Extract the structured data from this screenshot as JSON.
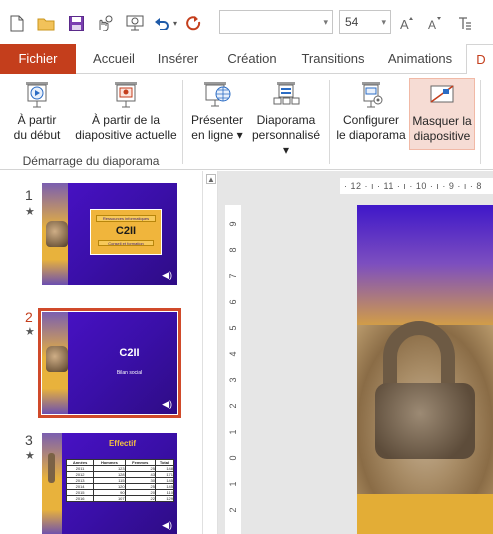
{
  "qat": {
    "font_size_value": "54"
  },
  "tabs": [
    {
      "label": "Fichier"
    },
    {
      "label": "Accueil"
    },
    {
      "label": "Insérer"
    },
    {
      "label": "Création"
    },
    {
      "label": "Transitions"
    },
    {
      "label": "Animations"
    },
    {
      "label": "D"
    }
  ],
  "ribbon": {
    "buttons": [
      {
        "line1": "À partir",
        "line2": "du début"
      },
      {
        "line1": "À partir de la",
        "line2": "diapositive actuelle"
      },
      {
        "line1": "Présenter",
        "line2": "en ligne ▾"
      },
      {
        "line1": "Diaporama",
        "line2": "personnalisé ▾"
      },
      {
        "line1": "Configurer",
        "line2": "le diaporama"
      },
      {
        "line1": "Masquer la",
        "line2": "diapositive"
      }
    ],
    "group_label": "Démarrage du diaporama"
  },
  "thumbnails": [
    {
      "number": "1",
      "title": "C2II",
      "subtitle": "Bilan social",
      "line_top": "Ressources informatiques",
      "line_bottom": "Conseil et formation",
      "selected": false
    },
    {
      "number": "2",
      "title": "C2II",
      "subtitle": "Bilan social",
      "selected": true
    },
    {
      "number": "3",
      "title": "Effectif",
      "selected": false,
      "table": {
        "headers": [
          "Années",
          "Hommes",
          "Femmes",
          "Total"
        ],
        "rows": [
          [
            "2011",
            "123",
            "25",
            "148"
          ],
          [
            "2012",
            "128",
            "43",
            "171"
          ],
          [
            "2013",
            "115",
            "30",
            "145"
          ],
          [
            "2014",
            "120",
            "25",
            "145"
          ],
          [
            "2015",
            "90",
            "20",
            "110"
          ],
          [
            "2016",
            "107",
            "22",
            "129"
          ]
        ]
      }
    }
  ],
  "ruler": {
    "horizontal": "· 12 · ı · 11 · ı · 10 · ı · 9 · ı · 8",
    "vertical": [
      "9",
      "8",
      "7",
      "6",
      "5",
      "4",
      "3",
      "2",
      "1",
      "0",
      "1",
      "2"
    ]
  },
  "colors": {
    "accent": "#c43e1c",
    "slide_purple": "#3f12c0",
    "slide_gold": "#e7b24a"
  }
}
